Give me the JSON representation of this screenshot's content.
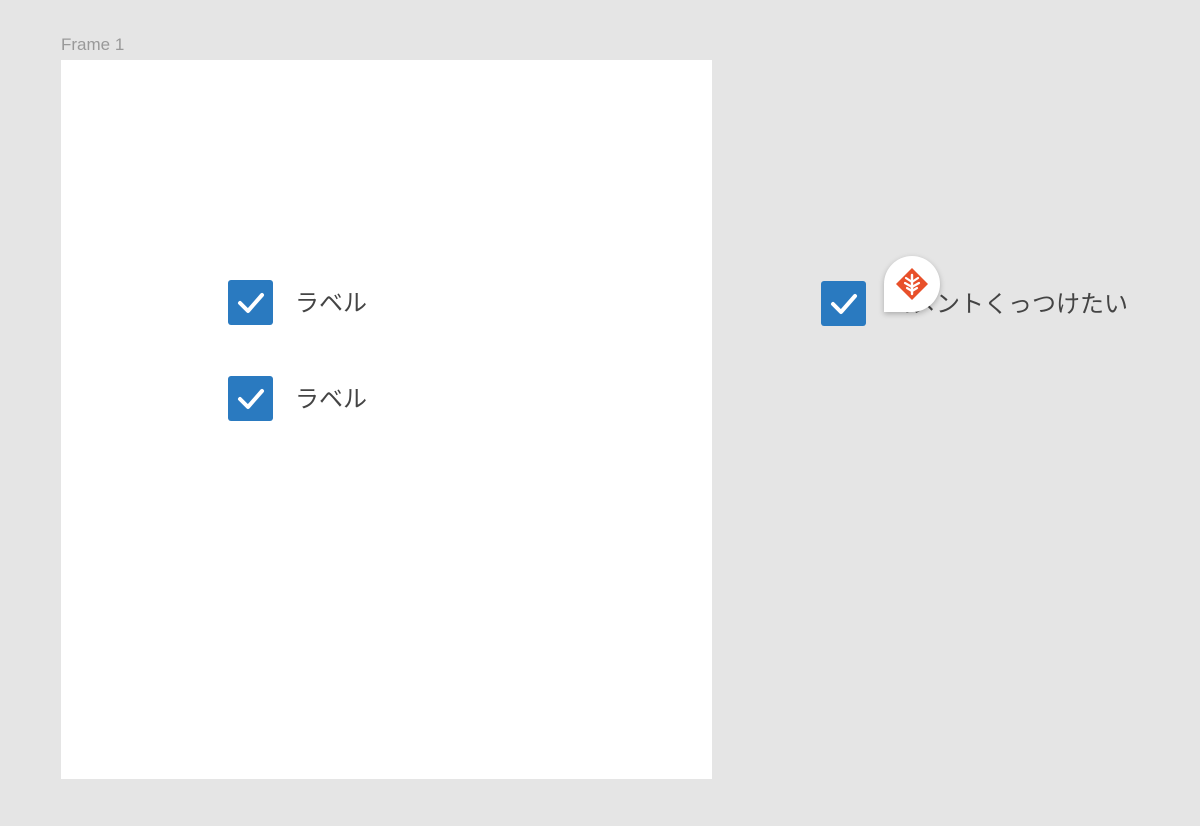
{
  "frame": {
    "label": "Frame 1"
  },
  "checkboxes": [
    {
      "label": "ラベル",
      "checked": true
    },
    {
      "label": "ラベル",
      "checked": true
    },
    {
      "label": "コメントくっつけたい",
      "checked": true
    }
  ],
  "comment_pin": {
    "icon": "tree-logo-icon"
  },
  "colors": {
    "canvas": "#e5e5e5",
    "frame": "#ffffff",
    "checkbox": "#2a7ac0",
    "label_text": "#444444",
    "frame_label": "#999999",
    "avatar": "#e8502a"
  }
}
